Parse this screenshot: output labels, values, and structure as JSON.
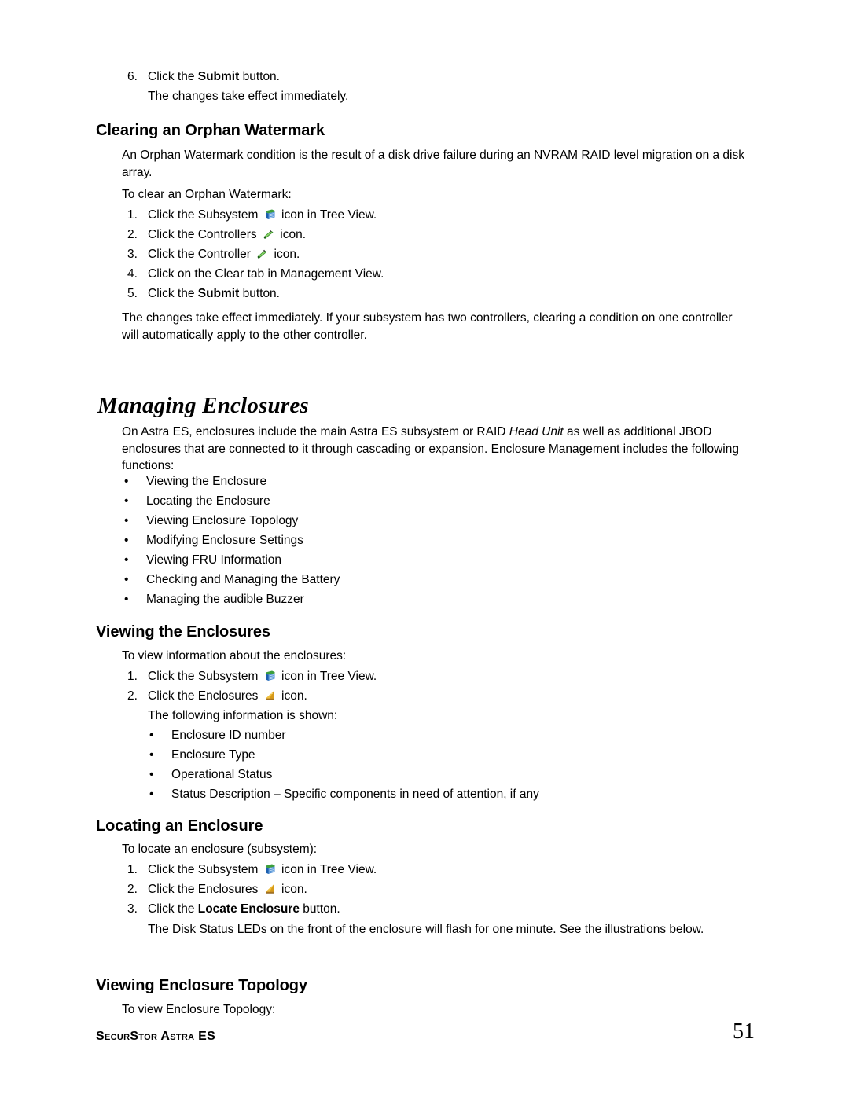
{
  "document": {
    "footer": {
      "left_text": "SecurStor Astra ES",
      "page_number": "51"
    }
  },
  "icons": {
    "subsystem": "subsystem-icon",
    "controllers": "controllers-icon",
    "controller": "controller-icon",
    "enclosures": "enclosures-icon"
  },
  "colors": {
    "subsystem_blue": "#2e6fbe",
    "subsystem_light": "#6fa8e6",
    "controller_green": "#2f7d27",
    "controller_light": "#7ac943",
    "enclosure_yellow": "#e8a81e",
    "enclosure_dark": "#8a5a12",
    "text": "#000000",
    "page_background": "#ffffff"
  },
  "top_step": {
    "number": "6.",
    "text_before": "Click the ",
    "bold": "Submit",
    "text_after": " button.",
    "sub_line": "The changes take effect immediately."
  },
  "section_orphan": {
    "heading": "Clearing an Orphan Watermark",
    "intro": "An Orphan Watermark condition is the result of a disk drive failure during an NVRAM RAID level migration on a disk array.",
    "lead_in": "To clear an Orphan Watermark:",
    "steps": [
      {
        "number": "1.",
        "pre": "Click the Subsystem ",
        "icon": "subsystem",
        "post": " icon in Tree View."
      },
      {
        "number": "2.",
        "pre": "Click the Controllers ",
        "icon": "controllers",
        "post": " icon."
      },
      {
        "number": "3.",
        "pre": "Click the Controller ",
        "icon": "controller",
        "post": " icon."
      },
      {
        "number": "4.",
        "pre": "Click on the Clear tab in Management View.",
        "icon": "",
        "post": ""
      },
      {
        "number": "5.",
        "pre": "Click the ",
        "icon": "",
        "bold": "Submit",
        "post": " button."
      }
    ],
    "closing": "The changes take effect immediately. If your subsystem has two controllers, clearing a condition on one controller will automatically apply to the other controller."
  },
  "section_managing": {
    "heading": "Managing Enclosures",
    "intro_1": "On Astra ES, enclosures include the main Astra ES subsystem or RAID ",
    "intro_italic": "Head Unit",
    "intro_2": " as well as additional JBOD enclosures that are connected to it through cascading or expansion. Enclosure Management includes the following functions:",
    "bullets": [
      "Viewing the Enclosure",
      "Locating the Enclosure",
      "Viewing Enclosure Topology",
      "Modifying Enclosure Settings",
      "Viewing FRU Information",
      "Checking and Managing the Battery",
      "Managing the audible Buzzer"
    ]
  },
  "section_viewing": {
    "heading": "Viewing the Enclosures",
    "lead_in": "To view information about the enclosures:",
    "steps": [
      {
        "number": "1.",
        "pre": "Click the Subsystem ",
        "icon": "subsystem",
        "post": " icon in Tree View."
      },
      {
        "number": "2.",
        "pre": "Click the Enclosures ",
        "icon": "enclosures",
        "post": " icon."
      }
    ],
    "sub_line": "The following information is shown:",
    "sub_bullets": [
      "Enclosure ID number",
      "Enclosure Type",
      "Operational Status",
      "Status Description – Specific components in need of attention, if any"
    ]
  },
  "section_locating": {
    "heading": "Locating an Enclosure",
    "lead_in": "To locate an enclosure (subsystem):",
    "steps": [
      {
        "number": "1.",
        "pre": "Click the Subsystem ",
        "icon": "subsystem",
        "post": " icon in Tree View."
      },
      {
        "number": "2.",
        "pre": "Click the Enclosures ",
        "icon": "enclosures",
        "post": " icon."
      },
      {
        "number": "3.",
        "pre": "Click the ",
        "icon": "",
        "bold": "Locate Enclosure",
        "post": " button."
      }
    ],
    "closing": "The Disk Status LEDs on the front of the enclosure will flash for one minute. See the illustrations below."
  },
  "section_topology": {
    "heading": "Viewing Enclosure Topology",
    "lead_in": "To view Enclosure Topology:"
  }
}
